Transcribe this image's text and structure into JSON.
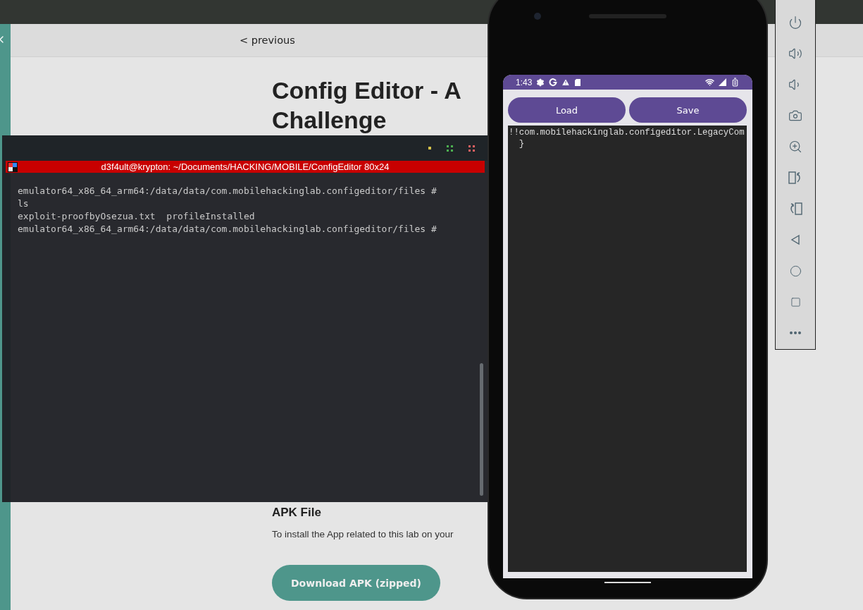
{
  "browser": {
    "nav": {
      "previous": "< previous"
    },
    "title_lines": [
      "Config Editor - A",
      "Challenge"
    ],
    "apk": {
      "heading": "APK File",
      "text": "To install the App related to this lab on your",
      "button": "Download APK (zipped)"
    }
  },
  "terminal": {
    "title": "d3f4ult@krypton: ~/Documents/HACKING/MOBILE/ConfigEditor 80x24",
    "lines": [
      "emulator64_x86_64_arm64:/data/data/com.mobilehackinglab.configeditor/files #",
      "ls",
      "exploit-proofbyOsezua.txt  profileInstalled",
      "emulator64_x86_64_arm64:/data/data/com.mobilehackinglab.configeditor/files #"
    ]
  },
  "phone": {
    "status_bar": {
      "time": "1:43"
    },
    "buttons": [
      "Load",
      "Save"
    ],
    "editor_lines": [
      "!!com.mobilehackinglab.configeditor.LegacyCom",
      "  }"
    ]
  }
}
